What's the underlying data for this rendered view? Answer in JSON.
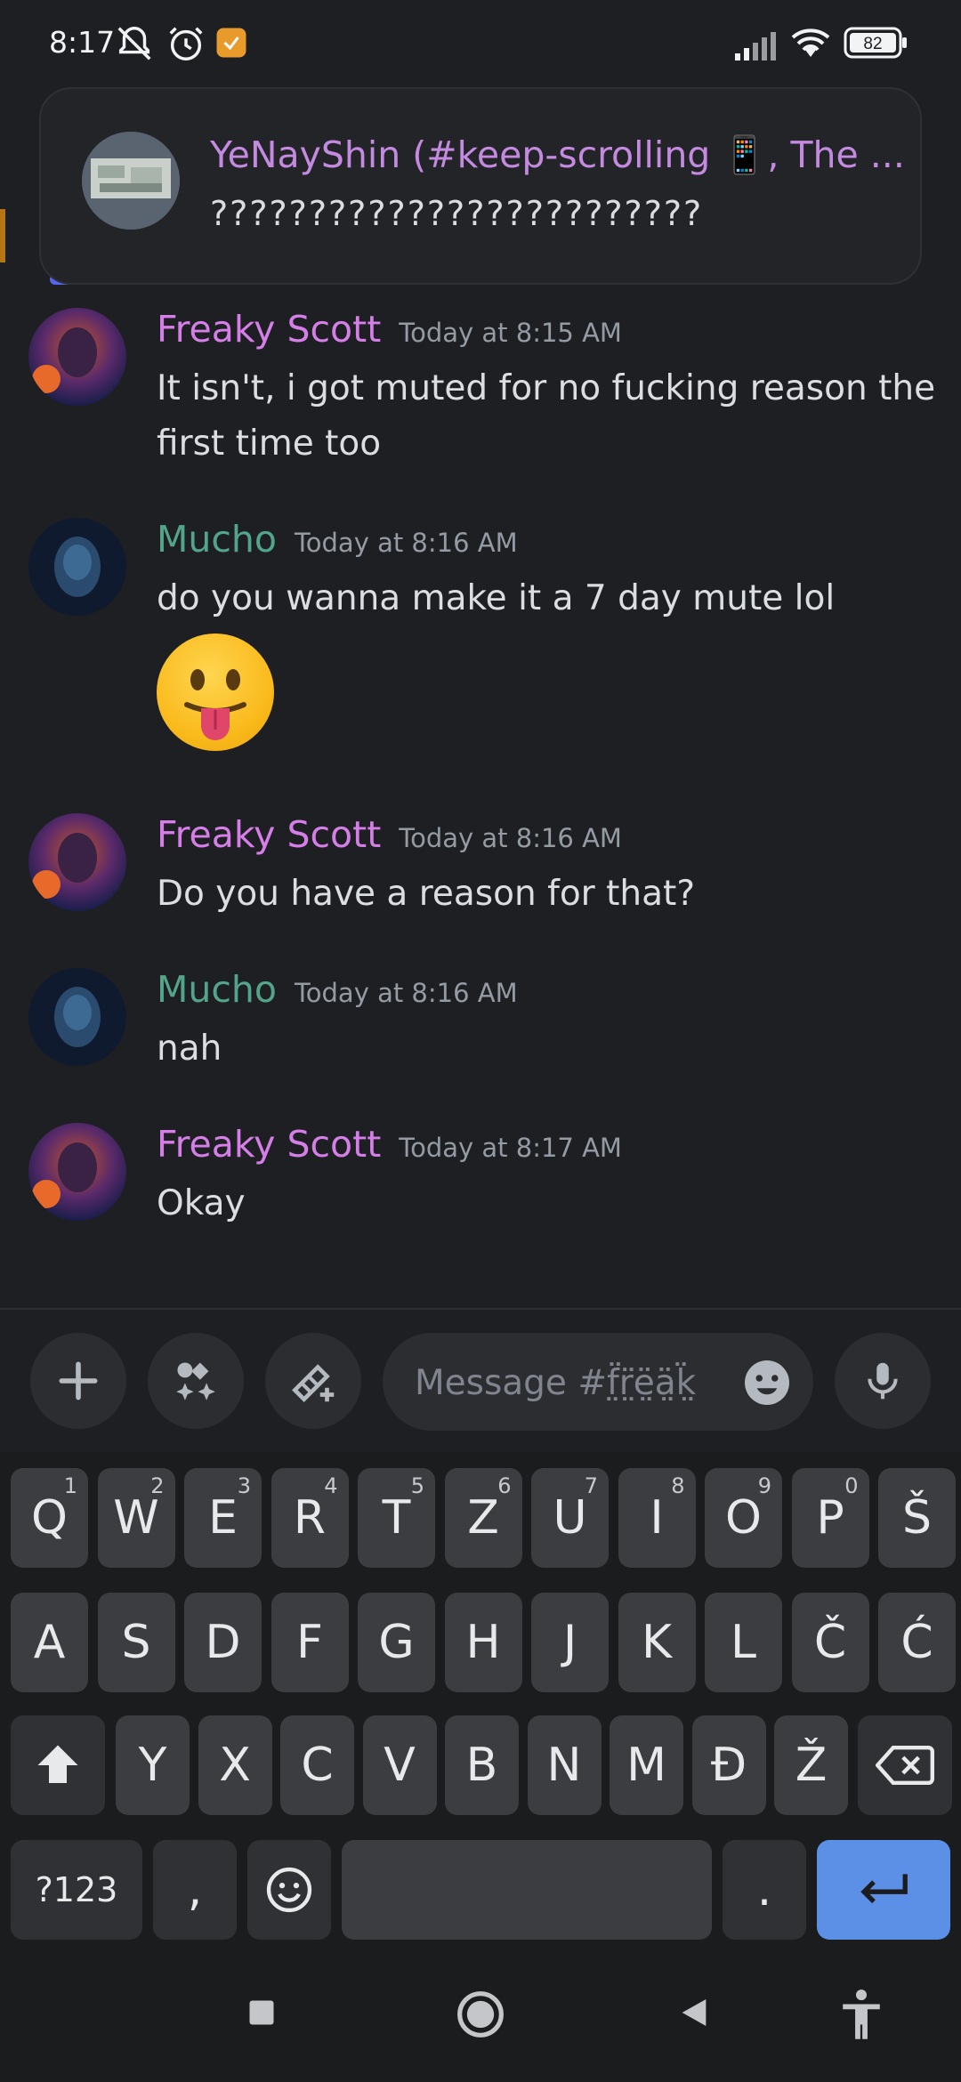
{
  "status_bar": {
    "time": "8:17",
    "battery": "82",
    "icons": [
      "notifications-off-icon",
      "alarm-icon",
      "app-notification-icon",
      "signal-icon",
      "wifi-icon",
      "battery-icon"
    ]
  },
  "notification": {
    "title": "YeNayShin (#keep-scrolling 📱, The ...",
    "body": "?????????????????????????"
  },
  "messages": [
    {
      "user": "Freaky Scott",
      "time": "Today at 8:15 AM",
      "text": "It isn't, i got muted for no fucking reason the first time too"
    },
    {
      "user": "Mucho",
      "time": "Today at 8:16 AM",
      "text": "do you wanna make it a 7 day mute lol",
      "emoji": "stuck-out-tongue-emoji"
    },
    {
      "user": "Freaky Scott",
      "time": "Today at 8:16 AM",
      "text": "Do you have a reason for that?"
    },
    {
      "user": "Mucho",
      "time": "Today at 8:16 AM",
      "text": "nah"
    },
    {
      "user": "Freaky Scott",
      "time": "Today at 8:17 AM",
      "text": "Okay"
    }
  ],
  "composer": {
    "placeholder": "Message #f̤̈r̤̈ë̤ä̤k̤̈"
  },
  "keyboard": {
    "row1": [
      {
        "k": "Q",
        "h": "1"
      },
      {
        "k": "W",
        "h": "2"
      },
      {
        "k": "E",
        "h": "3"
      },
      {
        "k": "R",
        "h": "4"
      },
      {
        "k": "T",
        "h": "5"
      },
      {
        "k": "Z",
        "h": "6"
      },
      {
        "k": "U",
        "h": "7"
      },
      {
        "k": "I",
        "h": "8"
      },
      {
        "k": "O",
        "h": "9"
      },
      {
        "k": "P",
        "h": "0"
      },
      {
        "k": "Š",
        "h": ""
      }
    ],
    "row2": [
      "A",
      "S",
      "D",
      "F",
      "G",
      "H",
      "J",
      "K",
      "L",
      "Č",
      "Ć"
    ],
    "row3": [
      "Y",
      "X",
      "C",
      "V",
      "B",
      "N",
      "M",
      "Đ",
      "Ž"
    ],
    "symbols": "?123",
    "comma": ",",
    "period": "."
  },
  "colors": {
    "scott": "#d57ee8",
    "mucho": "#52a58b",
    "enter": "#5c8fe6"
  }
}
